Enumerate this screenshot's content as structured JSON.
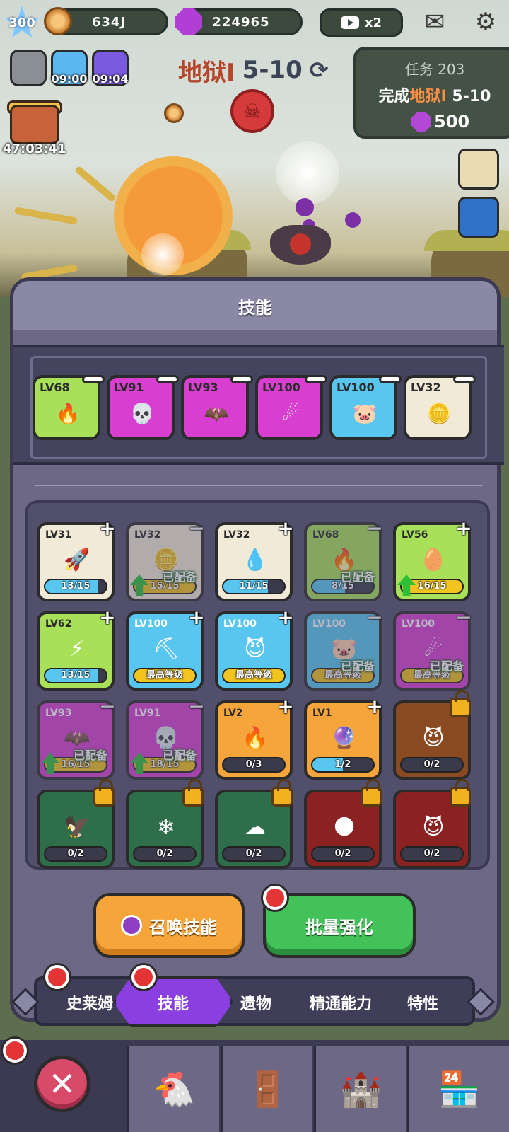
{
  "hud": {
    "level": "300",
    "coins": "634J",
    "gems": "224965",
    "speed": "x2",
    "icons": {
      "mail": "mail-icon",
      "settings": "gear-icon",
      "video": "video-ad-icon"
    }
  },
  "boosts": [
    {
      "name": "coin-stack-boost",
      "time": ""
    },
    {
      "name": "attack-boost",
      "time": "09:00"
    },
    {
      "name": "lightning-boost",
      "time": "09:04"
    }
  ],
  "chest": {
    "time": "47:03:41"
  },
  "stage": {
    "hell": "地狱",
    "roman": "I",
    "level": "5-10"
  },
  "quest": {
    "title": "任务 203",
    "prefix": "完成",
    "target": "地狱I",
    "level": " 5-10",
    "reward": "500"
  },
  "panel": {
    "title": "技能"
  },
  "equipped": [
    {
      "lv": "LV68",
      "color": "#a8e05a",
      "art": "🔥"
    },
    {
      "lv": "LV91",
      "color": "#d83fd0",
      "art": "💀"
    },
    {
      "lv": "LV93",
      "color": "#d83fd0",
      "art": "🦇"
    },
    {
      "lv": "LV100",
      "color": "#d83fd0",
      "art": "☄"
    },
    {
      "lv": "LV100",
      "color": "#59c6f0",
      "art": "🐷"
    },
    {
      "lv": "LV32",
      "color": "#f1ead6",
      "art": "🪙"
    }
  ],
  "skills": [
    {
      "lv": "LV31",
      "color": "#f1ead6",
      "art": "🚀",
      "bar": "13/15",
      "fill": 0.87,
      "gold": false,
      "action": "plus",
      "equipped": "",
      "up": false,
      "faded": false
    },
    {
      "lv": "LV32",
      "color": "#f1ead6",
      "art": "🪙",
      "bar": "15/15",
      "fill": 1.0,
      "gold": true,
      "action": "minus",
      "equipped": "已配备",
      "up": true,
      "faded": true
    },
    {
      "lv": "LV32",
      "color": "#f1ead6",
      "art": "💧",
      "bar": "11/15",
      "fill": 0.73,
      "gold": false,
      "action": "plus",
      "equipped": "",
      "up": false,
      "faded": false
    },
    {
      "lv": "LV68",
      "color": "#a8e05a",
      "art": "🔥",
      "bar": "8/15",
      "fill": 0.53,
      "gold": false,
      "action": "minus",
      "equipped": "已配备",
      "up": false,
      "faded": true
    },
    {
      "lv": "LV56",
      "color": "#a8e05a",
      "art": "🥚",
      "bar": "16/15",
      "fill": 1.0,
      "gold": true,
      "action": "plus",
      "equipped": "",
      "up": true,
      "faded": false
    },
    {
      "lv": "LV62",
      "color": "#a8e05a",
      "art": "⚡",
      "bar": "13/15",
      "fill": 0.87,
      "gold": false,
      "action": "plus",
      "equipped": "",
      "up": false,
      "faded": false
    },
    {
      "lv": "LV100",
      "color": "#59c6f0",
      "art": "⛏",
      "bar": "最高等级",
      "fill": 1.0,
      "gold": true,
      "action": "plus",
      "equipped": "",
      "up": false,
      "faded": false
    },
    {
      "lv": "LV100",
      "color": "#59c6f0",
      "art": "😈",
      "bar": "最高等级",
      "fill": 1.0,
      "gold": true,
      "action": "plus",
      "equipped": "",
      "up": false,
      "faded": false
    },
    {
      "lv": "LV100",
      "color": "#59c6f0",
      "art": "🐷",
      "bar": "最高等级",
      "fill": 1.0,
      "gold": true,
      "action": "minus",
      "equipped": "已配备",
      "up": false,
      "faded": true
    },
    {
      "lv": "LV100",
      "color": "#d83fd0",
      "art": "☄",
      "bar": "最高等级",
      "fill": 1.0,
      "gold": true,
      "action": "minus",
      "equipped": "已配备",
      "up": false,
      "faded": true
    },
    {
      "lv": "LV93",
      "color": "#d83fd0",
      "art": "🦇",
      "bar": "16/15",
      "fill": 1.0,
      "gold": true,
      "action": "minus",
      "equipped": "已配备",
      "up": true,
      "faded": true
    },
    {
      "lv": "LV91",
      "color": "#d83fd0",
      "art": "💀",
      "bar": "18/15",
      "fill": 1.0,
      "gold": true,
      "action": "minus",
      "equipped": "已配备",
      "up": true,
      "faded": true
    },
    {
      "lv": "LV2",
      "color": "#f5a53a",
      "art": "🔥",
      "bar": "0/3",
      "fill": 0.0,
      "gold": false,
      "action": "plus",
      "equipped": "",
      "up": false,
      "faded": false
    },
    {
      "lv": "LV1",
      "color": "#f5a53a",
      "art": "🔮",
      "bar": "1/2",
      "fill": 0.5,
      "gold": false,
      "action": "plus",
      "equipped": "",
      "up": false,
      "faded": false
    },
    {
      "lv": "",
      "color": "#8a4a22",
      "art": "😈",
      "bar": "0/2",
      "fill": 0.0,
      "gold": false,
      "action": "lock",
      "equipped": "",
      "up": false,
      "faded": false
    },
    {
      "lv": "",
      "color": "#2f6e4a",
      "art": "🦅",
      "bar": "0/2",
      "fill": 0.0,
      "gold": false,
      "action": "lock",
      "equipped": "",
      "up": false,
      "faded": false
    },
    {
      "lv": "",
      "color": "#2f6e4a",
      "art": "❄",
      "bar": "0/2",
      "fill": 0.0,
      "gold": false,
      "action": "lock",
      "equipped": "",
      "up": false,
      "faded": false
    },
    {
      "lv": "",
      "color": "#2f6e4a",
      "art": "☁",
      "bar": "0/2",
      "fill": 0.0,
      "gold": false,
      "action": "lock",
      "equipped": "",
      "up": false,
      "faded": false
    },
    {
      "lv": "",
      "color": "#8a2222",
      "art": "🌑",
      "bar": "0/2",
      "fill": 0.0,
      "gold": false,
      "action": "lock",
      "equipped": "",
      "up": false,
      "faded": false
    },
    {
      "lv": "",
      "color": "#8a2222",
      "art": "😈",
      "bar": "0/2",
      "fill": 0.0,
      "gold": false,
      "action": "lock",
      "equipped": "",
      "up": false,
      "faded": false
    }
  ],
  "buttons": {
    "summon": "召唤技能",
    "batch": "批量强化"
  },
  "tabs": [
    "史莱姆",
    "技能",
    "遗物",
    "精通能力",
    "特性"
  ],
  "nav": {
    "close": "✕",
    "slots": [
      "🐔",
      "🚪",
      "🏰",
      "🏪"
    ]
  }
}
